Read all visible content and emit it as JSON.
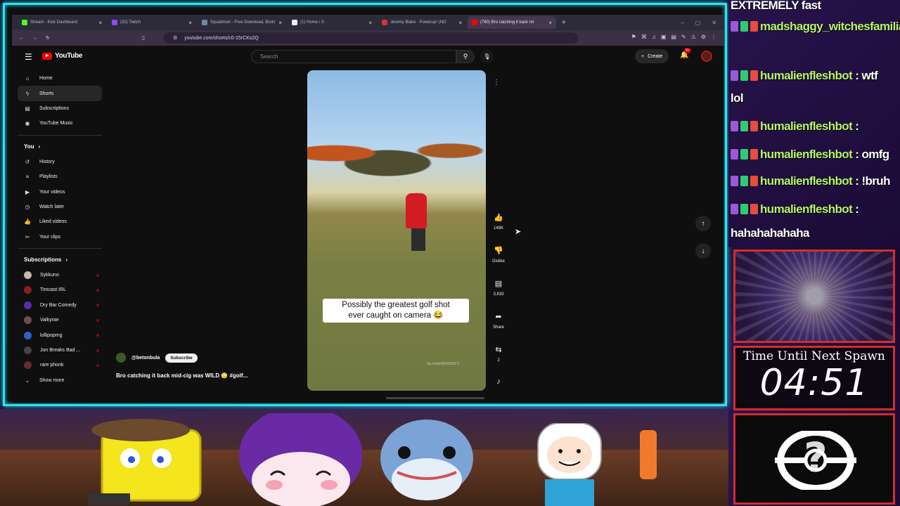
{
  "browser": {
    "tabs": [
      {
        "label": "Stream - Kick Dashboard",
        "color": "#53fc18"
      },
      {
        "label": "(32) Twitch",
        "color": "#9146ff"
      },
      {
        "label": "Squadman - Free Download, Borin",
        "color": "#6f8ba3"
      },
      {
        "label": "(1) Home / X",
        "color": "#eeeeee"
      },
      {
        "label": "Jeremy Blake - Powerup! (NO",
        "color": "#e03030"
      },
      {
        "label": "(780) Bro catching it back mi",
        "color": "#ff0000"
      }
    ],
    "url": "youtube.com/shorts/c0-15rCKs2Q"
  },
  "youtube": {
    "logo": "YouTube",
    "search_placeholder": "Search",
    "create_label": "Create",
    "bell_badge": "9+",
    "nav": [
      {
        "label": "Home",
        "icon": "home-icon",
        "glyph": "⌂"
      },
      {
        "label": "Shorts",
        "icon": "shorts-icon",
        "glyph": "ϟ"
      },
      {
        "label": "Subscriptions",
        "icon": "subscriptions-icon",
        "glyph": "▤"
      },
      {
        "label": "YouTube Music",
        "icon": "music-icon",
        "glyph": "◉"
      }
    ],
    "you_label": "You",
    "you_items": [
      {
        "label": "History",
        "icon": "history-icon",
        "glyph": "↺"
      },
      {
        "label": "Playlists",
        "icon": "playlists-icon",
        "glyph": "≡"
      },
      {
        "label": "Your videos",
        "icon": "your-videos-icon",
        "glyph": "▶"
      },
      {
        "label": "Watch later",
        "icon": "watch-later-icon",
        "glyph": "◷"
      },
      {
        "label": "Liked videos",
        "icon": "liked-videos-icon",
        "glyph": "👍"
      },
      {
        "label": "Your clips",
        "icon": "clips-icon",
        "glyph": "✂"
      }
    ],
    "subscriptions_label": "Subscriptions",
    "subscriptions": [
      {
        "label": "Sykkuno",
        "color": "#c9b7a8"
      },
      {
        "label": "Timcast IRL",
        "color": "#8a2020"
      },
      {
        "label": "Dry Bar Comedy",
        "color": "#5b2ba8"
      },
      {
        "label": "Valkyrae",
        "color": "#6d5048"
      },
      {
        "label": "lollipopmg",
        "color": "#2b63c6"
      },
      {
        "label": "Jon Breaks Bad ...",
        "color": "#444444"
      },
      {
        "label": "rare phonk",
        "color": "#6a2b2b"
      }
    ],
    "show_more": "Show more",
    "video": {
      "caption_line1": "Possibly the greatest golf shot",
      "caption_line2": "ever caught on camera 😂",
      "watermark": "via misie96005990 X",
      "channel": "@betonbula",
      "subscribe": "Subscribe",
      "title": "Bro catching it back mid-cig was WILD 😳 #golf..."
    },
    "actions": {
      "likes": "148K",
      "dislike": "Dislike",
      "comments": "3,633",
      "share": "Share",
      "remix": "2"
    }
  },
  "chat": {
    "lines": [
      {
        "user": "",
        "msg": "EXTREMELY fast"
      },
      {
        "user": "madshaggy_witchesfamiliar",
        "msg": ":"
      },
      {
        "user": "humalienfleshbot",
        "msg": ": wtf"
      },
      {
        "user": "",
        "msg": "lol"
      },
      {
        "user": "humalienfleshbot",
        "msg": ":"
      },
      {
        "user": "humalienfleshbot",
        "msg": ": omfg"
      },
      {
        "user": "humalienfleshbot",
        "msg": ": !bruh"
      },
      {
        "user": "humalienfleshbot",
        "msg": ":"
      },
      {
        "user": "",
        "msg": "hahahahahaha"
      }
    ]
  },
  "overlay": {
    "timer_label": "Time Until Next Spawn",
    "timer_value": "04:51"
  }
}
